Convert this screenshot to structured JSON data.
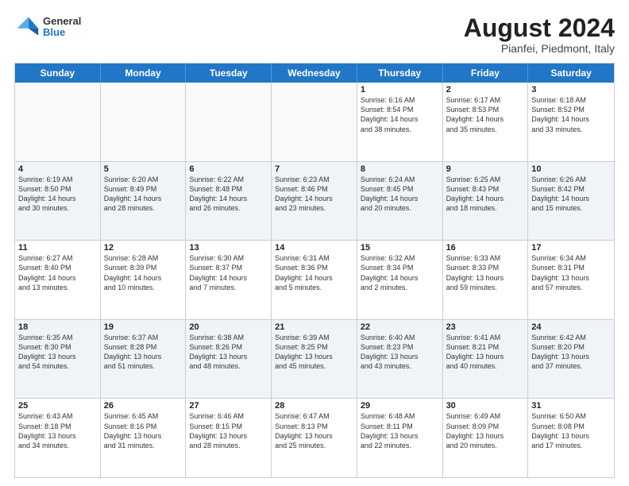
{
  "header": {
    "logo": {
      "general": "General",
      "blue": "Blue"
    },
    "title": "August 2024",
    "location": "Pianfei, Piedmont, Italy"
  },
  "weekdays": [
    "Sunday",
    "Monday",
    "Tuesday",
    "Wednesday",
    "Thursday",
    "Friday",
    "Saturday"
  ],
  "rows": [
    [
      {
        "day": "",
        "info": "",
        "empty": true
      },
      {
        "day": "",
        "info": "",
        "empty": true
      },
      {
        "day": "",
        "info": "",
        "empty": true
      },
      {
        "day": "",
        "info": "",
        "empty": true
      },
      {
        "day": "1",
        "info": "Sunrise: 6:16 AM\nSunset: 8:54 PM\nDaylight: 14 hours\nand 38 minutes."
      },
      {
        "day": "2",
        "info": "Sunrise: 6:17 AM\nSunset: 8:53 PM\nDaylight: 14 hours\nand 35 minutes."
      },
      {
        "day": "3",
        "info": "Sunrise: 6:18 AM\nSunset: 8:52 PM\nDaylight: 14 hours\nand 33 minutes."
      }
    ],
    [
      {
        "day": "4",
        "info": "Sunrise: 6:19 AM\nSunset: 8:50 PM\nDaylight: 14 hours\nand 30 minutes."
      },
      {
        "day": "5",
        "info": "Sunrise: 6:20 AM\nSunset: 8:49 PM\nDaylight: 14 hours\nand 28 minutes."
      },
      {
        "day": "6",
        "info": "Sunrise: 6:22 AM\nSunset: 8:48 PM\nDaylight: 14 hours\nand 26 minutes."
      },
      {
        "day": "7",
        "info": "Sunrise: 6:23 AM\nSunset: 8:46 PM\nDaylight: 14 hours\nand 23 minutes."
      },
      {
        "day": "8",
        "info": "Sunrise: 6:24 AM\nSunset: 8:45 PM\nDaylight: 14 hours\nand 20 minutes."
      },
      {
        "day": "9",
        "info": "Sunrise: 6:25 AM\nSunset: 8:43 PM\nDaylight: 14 hours\nand 18 minutes."
      },
      {
        "day": "10",
        "info": "Sunrise: 6:26 AM\nSunset: 8:42 PM\nDaylight: 14 hours\nand 15 minutes."
      }
    ],
    [
      {
        "day": "11",
        "info": "Sunrise: 6:27 AM\nSunset: 8:40 PM\nDaylight: 14 hours\nand 13 minutes."
      },
      {
        "day": "12",
        "info": "Sunrise: 6:28 AM\nSunset: 8:39 PM\nDaylight: 14 hours\nand 10 minutes."
      },
      {
        "day": "13",
        "info": "Sunrise: 6:30 AM\nSunset: 8:37 PM\nDaylight: 14 hours\nand 7 minutes."
      },
      {
        "day": "14",
        "info": "Sunrise: 6:31 AM\nSunset: 8:36 PM\nDaylight: 14 hours\nand 5 minutes."
      },
      {
        "day": "15",
        "info": "Sunrise: 6:32 AM\nSunset: 8:34 PM\nDaylight: 14 hours\nand 2 minutes."
      },
      {
        "day": "16",
        "info": "Sunrise: 6:33 AM\nSunset: 8:33 PM\nDaylight: 13 hours\nand 59 minutes."
      },
      {
        "day": "17",
        "info": "Sunrise: 6:34 AM\nSunset: 8:31 PM\nDaylight: 13 hours\nand 57 minutes."
      }
    ],
    [
      {
        "day": "18",
        "info": "Sunrise: 6:35 AM\nSunset: 8:30 PM\nDaylight: 13 hours\nand 54 minutes."
      },
      {
        "day": "19",
        "info": "Sunrise: 6:37 AM\nSunset: 8:28 PM\nDaylight: 13 hours\nand 51 minutes."
      },
      {
        "day": "20",
        "info": "Sunrise: 6:38 AM\nSunset: 8:26 PM\nDaylight: 13 hours\nand 48 minutes."
      },
      {
        "day": "21",
        "info": "Sunrise: 6:39 AM\nSunset: 8:25 PM\nDaylight: 13 hours\nand 45 minutes."
      },
      {
        "day": "22",
        "info": "Sunrise: 6:40 AM\nSunset: 8:23 PM\nDaylight: 13 hours\nand 43 minutes."
      },
      {
        "day": "23",
        "info": "Sunrise: 6:41 AM\nSunset: 8:21 PM\nDaylight: 13 hours\nand 40 minutes."
      },
      {
        "day": "24",
        "info": "Sunrise: 6:42 AM\nSunset: 8:20 PM\nDaylight: 13 hours\nand 37 minutes."
      }
    ],
    [
      {
        "day": "25",
        "info": "Sunrise: 6:43 AM\nSunset: 8:18 PM\nDaylight: 13 hours\nand 34 minutes."
      },
      {
        "day": "26",
        "info": "Sunrise: 6:45 AM\nSunset: 8:16 PM\nDaylight: 13 hours\nand 31 minutes."
      },
      {
        "day": "27",
        "info": "Sunrise: 6:46 AM\nSunset: 8:15 PM\nDaylight: 13 hours\nand 28 minutes."
      },
      {
        "day": "28",
        "info": "Sunrise: 6:47 AM\nSunset: 8:13 PM\nDaylight: 13 hours\nand 25 minutes."
      },
      {
        "day": "29",
        "info": "Sunrise: 6:48 AM\nSunset: 8:11 PM\nDaylight: 13 hours\nand 22 minutes."
      },
      {
        "day": "30",
        "info": "Sunrise: 6:49 AM\nSunset: 8:09 PM\nDaylight: 13 hours\nand 20 minutes."
      },
      {
        "day": "31",
        "info": "Sunrise: 6:50 AM\nSunset: 8:08 PM\nDaylight: 13 hours\nand 17 minutes."
      }
    ]
  ]
}
